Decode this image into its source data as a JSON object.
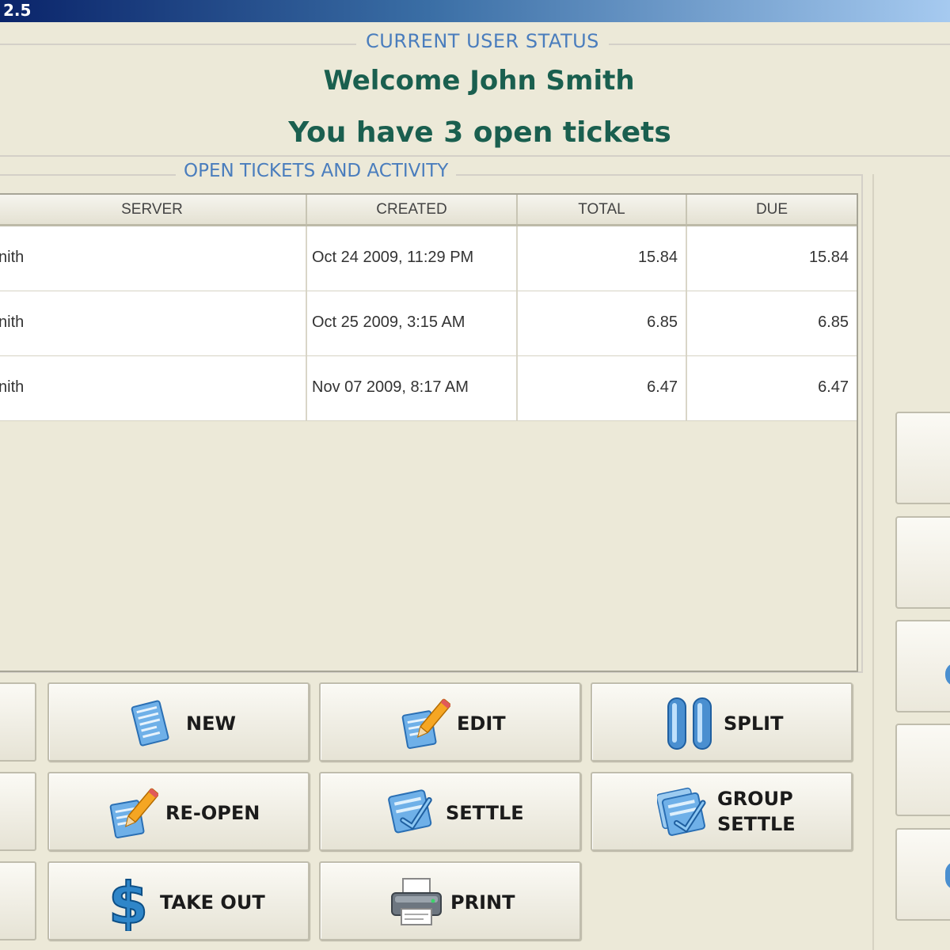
{
  "window": {
    "title_fragment": "2.5"
  },
  "status": {
    "legend": "CURRENT USER STATUS",
    "welcome": "Welcome John Smith",
    "open_tickets": "You have 3 open tickets"
  },
  "tickets": {
    "legend": "OPEN TICKETS AND ACTIVITY",
    "columns": [
      "SERVER",
      "CREATED",
      "TOTAL",
      "DUE"
    ],
    "rows": [
      {
        "server": "nith",
        "created": "Oct 24 2009, 11:29 PM",
        "total": "15.84",
        "due": "15.84"
      },
      {
        "server": "nith",
        "created": "Oct 25 2009, 3:15 AM",
        "total": "6.85",
        "due": "6.85"
      },
      {
        "server": "nith",
        "created": "Nov 07 2009, 8:17 AM",
        "total": "6.47",
        "due": "6.47"
      }
    ]
  },
  "actions": {
    "new": "NEW",
    "edit": "EDIT",
    "split": "SPLIT",
    "reopen": "RE-OPEN",
    "settle": "SETTLE",
    "group_settle_line1": "GROUP",
    "group_settle_line2": "SETTLE",
    "take_out": "TAKE OUT",
    "print": "PRINT"
  },
  "icons": {
    "new": "document-icon",
    "edit": "pencil-document-icon",
    "split": "split-icon",
    "reopen": "pencil-document-icon",
    "settle": "settle-icon",
    "group_settle": "group-settle-icon",
    "take_out": "dollar-icon",
    "print": "printer-icon"
  },
  "colors": {
    "accent_green": "#1a5f4f",
    "legend_blue": "#4a7dbd",
    "background": "#ece9d8"
  }
}
